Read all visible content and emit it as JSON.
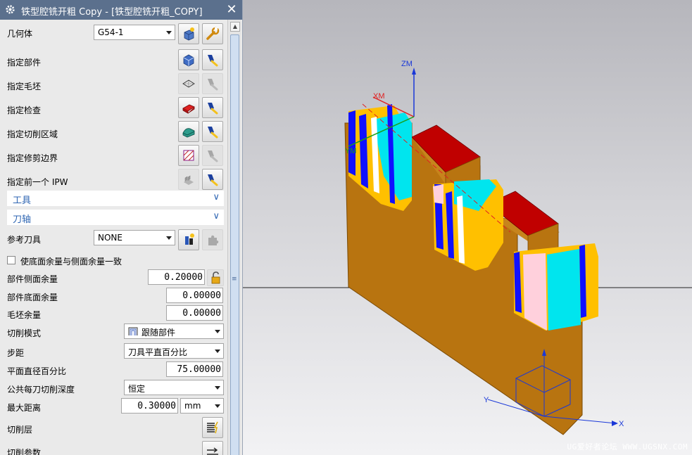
{
  "dialog": {
    "title": "铁型腔铣开粗 Copy - [铁型腔铣开粗_COPY]",
    "close_glyph": "✕"
  },
  "geometry": {
    "label": "几何体",
    "value": "G54-1",
    "rows": [
      {
        "label": "指定部件",
        "icon": "part-box-icon",
        "enabled": true
      },
      {
        "label": "指定毛坯",
        "icon": "blank-wireframe-icon",
        "enabled": false
      },
      {
        "label": "指定检查",
        "icon": "check-red-block-icon",
        "enabled": true
      },
      {
        "label": "指定切削区域",
        "icon": "cut-area-icon",
        "enabled": true
      },
      {
        "label": "指定修剪边界",
        "icon": "trim-boundary-icon",
        "enabled": false
      },
      {
        "label": "指定前一个 IPW",
        "icon": "previous-ipw-icon",
        "enabled": true
      }
    ]
  },
  "sections": {
    "tool": "工具",
    "axis": "刀轴"
  },
  "ref_tool": {
    "label": "参考刀具",
    "value": "NONE"
  },
  "options": {
    "same_stock_checkbox": "使底面余量与侧面余量一致",
    "checked": false
  },
  "fields": {
    "side_stock": {
      "label": "部件侧面余量",
      "value": "0.20000"
    },
    "floor_stock": {
      "label": "部件底面余量",
      "value": "0.00000"
    },
    "blank_stock": {
      "label": "毛坯余量",
      "value": "0.00000"
    },
    "cut_pattern": {
      "label": "切削模式",
      "value": "跟随部件"
    },
    "stepover": {
      "label": "步距",
      "value": "刀具平直百分比"
    },
    "flat_percent": {
      "label": "平面直径百分比",
      "value": "75.00000"
    },
    "depth_per_cut": {
      "label": "公共每刀切削深度",
      "value": "恒定"
    },
    "max_distance": {
      "label": "最大距离",
      "value": "0.30000",
      "unit": "mm"
    },
    "cut_levels": {
      "label": "切削层"
    },
    "cut_params": {
      "label": "切削参数"
    }
  },
  "viewport": {
    "axis_labels": {
      "zm": "ZM",
      "xm": "XM",
      "ym": "YM",
      "x": "X",
      "y": "Y"
    },
    "watermark": "UG爱好者论坛 WWW.UGSNX.COM"
  }
}
